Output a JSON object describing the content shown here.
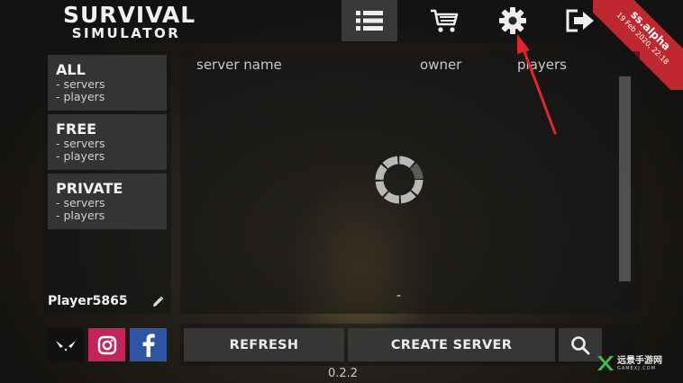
{
  "header": {
    "logo_line1": "SURVIVAL",
    "logo_line2": "SIMULATOR",
    "nav": [
      {
        "name": "server-list",
        "icon": "list-icon",
        "active": true
      },
      {
        "name": "shop",
        "icon": "cart-icon"
      },
      {
        "name": "settings",
        "icon": "gear-icon"
      },
      {
        "name": "exit",
        "icon": "exit-icon"
      }
    ],
    "ribbon": {
      "title": "ss.alpha",
      "date": "19 Feb 2020, 22:18"
    }
  },
  "categories": [
    {
      "title": "ALL",
      "line1": "- servers",
      "line2": "- players"
    },
    {
      "title": "FREE",
      "line1": "- servers",
      "line2": "- players"
    },
    {
      "title": "PRIVATE",
      "line1": "- servers",
      "line2": "- players"
    }
  ],
  "player": {
    "name": "Player5865"
  },
  "server_list": {
    "columns": [
      "server name",
      "owner",
      "players"
    ],
    "status": "-"
  },
  "social": [
    {
      "name": "alien",
      "icon": "alien-icon",
      "color": "#111111"
    },
    {
      "name": "instagram",
      "icon": "instagram-icon",
      "color": "#c4245e"
    },
    {
      "name": "facebook",
      "icon": "facebook-icon",
      "color": "#2f56a6"
    }
  ],
  "actions": {
    "refresh": "REFRESH",
    "create_server": "CREATE SERVER",
    "search_icon": "search-icon"
  },
  "version": "0.2.2",
  "watermark": {
    "line1": "远景手游网",
    "line2": "GAMEXJ.COM"
  },
  "colors": {
    "ribbon": "#c0282f",
    "annotation_arrow": "#e0262b"
  }
}
